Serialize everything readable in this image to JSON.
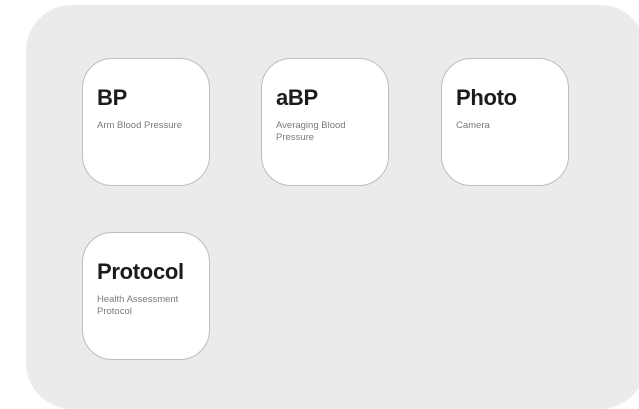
{
  "tiles": [
    {
      "title": "BP",
      "subtitle": "Arm Blood Pressure"
    },
    {
      "title": "aBP",
      "subtitle": "Averaging Blood Pressure"
    },
    {
      "title": "Photo",
      "subtitle": "Camera"
    },
    {
      "title": "Protocol",
      "subtitle": "Health Assessment Protocol"
    }
  ]
}
